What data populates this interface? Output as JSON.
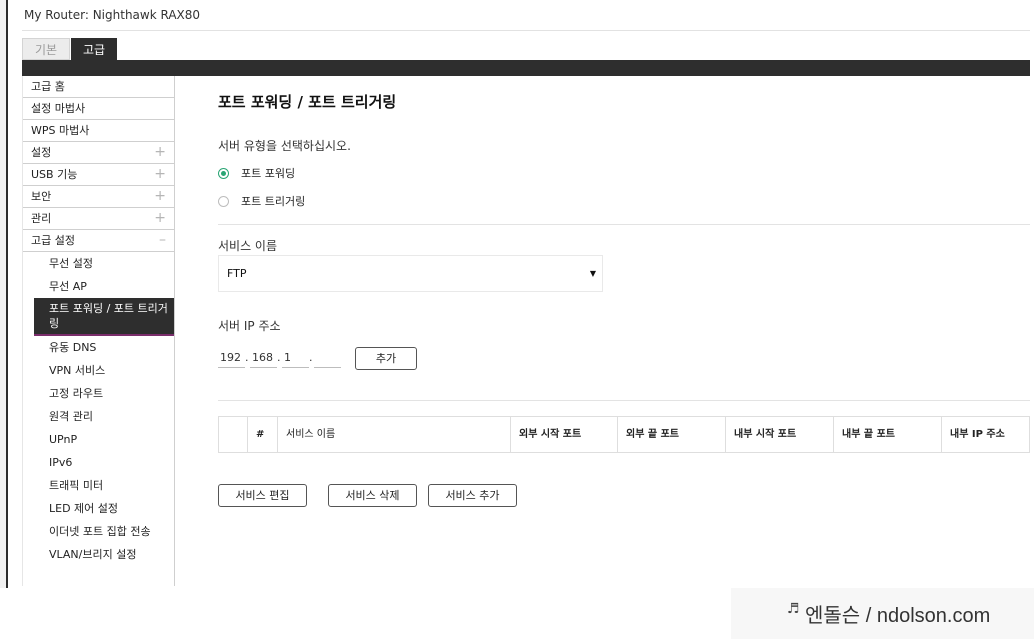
{
  "header": {
    "router_label": "My Router:",
    "router_name": "Nighthawk RAX80"
  },
  "tabs": [
    {
      "label": "기본",
      "active": false
    },
    {
      "label": "고급",
      "active": true
    }
  ],
  "sidebar": {
    "items": [
      {
        "label": "고급 홈"
      },
      {
        "label": "설정 마법사"
      },
      {
        "label": "WPS 마법사"
      },
      {
        "label": "설정",
        "expander": "+"
      },
      {
        "label": "USB 기능",
        "expander": "+"
      },
      {
        "label": "보안",
        "expander": "+"
      },
      {
        "label": "관리",
        "expander": "+"
      },
      {
        "label": "고급 설정",
        "expander": "–"
      }
    ],
    "subitems": [
      {
        "label": "무선 설정"
      },
      {
        "label": "무선 AP"
      },
      {
        "label": "포트 포워딩 / 포트 트리거링",
        "active": true
      },
      {
        "label": "유동 DNS"
      },
      {
        "label": "VPN 서비스"
      },
      {
        "label": "고정 라우트"
      },
      {
        "label": "원격 관리"
      },
      {
        "label": "UPnP"
      },
      {
        "label": "IPv6"
      },
      {
        "label": "트래픽 미터"
      },
      {
        "label": "LED 제어 설정"
      },
      {
        "label": "이더넷 포트 집합 전송"
      },
      {
        "label": "VLAN/브리지 설정"
      }
    ]
  },
  "main": {
    "title": "포트 포워딩 / 포트 트리거링",
    "server_type_prompt": "서버 유형을 선택하십시오.",
    "options": [
      {
        "label": "포트 포워딩",
        "checked": true
      },
      {
        "label": "포트 트리거링",
        "checked": false
      }
    ],
    "service_name_label": "서비스 이름",
    "service_select_value": "FTP",
    "server_ip_label": "서버 IP 주소",
    "ip_octets": [
      "192",
      "168",
      "1",
      ""
    ],
    "add_button": "추가",
    "table_headers": [
      "",
      "#",
      "서비스 이름",
      "외부 시작 포트",
      "외부 끝 포트",
      "내부 시작 포트",
      "내부 끝 포트",
      "내부 IP 주소"
    ],
    "buttons": {
      "edit": "서비스 편집",
      "delete": "서비스 삭제",
      "add_service": "서비스 추가"
    }
  },
  "watermark": {
    "note_symbol": "♬",
    "text": "엔돌슨 / ndolson.com"
  },
  "colors": {
    "accent_green": "#2aa574",
    "dark_bar": "#2e2e2e",
    "active_border": "#7a2d6b"
  }
}
